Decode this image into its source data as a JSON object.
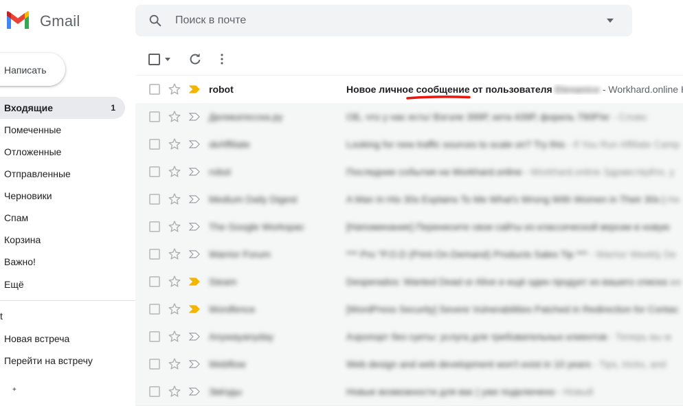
{
  "app": {
    "name": "Gmail",
    "brand_colors": {
      "red": "#ea4335",
      "blue": "#4285f4",
      "green": "#34a853",
      "yellow": "#fbbc04"
    }
  },
  "search": {
    "placeholder": "Поиск в почте",
    "value": ""
  },
  "compose": {
    "label": "Написать"
  },
  "sidebar": {
    "items": [
      {
        "label": "Входящие",
        "count": "1",
        "active": true
      },
      {
        "label": "Помеченные"
      },
      {
        "label": "Отложенные"
      },
      {
        "label": "Отправленные"
      },
      {
        "label": "Черновики"
      },
      {
        "label": "Спам"
      },
      {
        "label": "Корзина"
      },
      {
        "label": "Важно!"
      },
      {
        "label": "Ещё"
      }
    ],
    "meet": {
      "items": [
        {
          "label": "Новая встреча"
        },
        {
          "label": "Перейти на встречу"
        }
      ]
    }
  },
  "toolbar": {
    "icons": [
      "checkbox-icon",
      "chevron-down-icon",
      "refresh-icon",
      "more-vert-icon"
    ]
  },
  "messages": [
    {
      "sender": "robot",
      "subject": "Новое личное сообщение от пользователя",
      "redacted_name": "Elenanice",
      "snippet": " - Workhard.online Ho",
      "unread": true,
      "important": true,
      "underline_color": "#e8160c"
    },
    {
      "sender": "Деликатесска.ру",
      "subject": "ОБ, что у нас есть! Вэгэле 399Р, кета 439Р, форель 790Р/кг",
      "snippet": " - Слово",
      "important": false
    },
    {
      "sender": "skAffiliate",
      "subject": "Looking for new traffic sources to scale on? Try this",
      "snippet": " - If You Run Affiliate Camp",
      "important": false
    },
    {
      "sender": "robot",
      "subject": "Последние события на Workhard.online",
      "snippet": " - Workhard.online Здравствуйте, у",
      "important": false
    },
    {
      "sender": "Medium Daily Digest",
      "subject": "A Man In His 30s Explains To Me What's Wrong With Women in Their 30s |",
      "snippet": " He",
      "important": false
    },
    {
      "sender": "The Google Workspac",
      "subject": "[Напоминание] Перенесите свои сайты из классической версии в новую",
      "snippet": "",
      "important": false
    },
    {
      "sender": "Warrior Forum",
      "subject": "*** Pro \"P.O.D (Print-On-Demand) Products Sales Tip ***",
      "snippet": " - Warrior Weekly De",
      "important": false
    },
    {
      "sender": "Steam",
      "subject": "Desperados: Wanted Dead or Alive и ещё один продукт из вашего списка",
      "snippet": " же",
      "important": true
    },
    {
      "sender": "Wordfence",
      "subject": "[WordPress Security] Severe Vulnerabilities Patched in Redirection for Contac",
      "snippet": "",
      "important": true
    },
    {
      "sender": "Anywayanyday",
      "subject": "Аэропорт без суеты: услуга для требовательных клиентов",
      "snippet": " - Теперь вы м",
      "important": false
    },
    {
      "sender": "Webflow",
      "subject": "Web design and web development won't exist in 10 years",
      "snippet": " - Tips, tricks, and",
      "important": false
    },
    {
      "sender": "Звёзды",
      "subject": "Новые возможности для вас | уже подключено",
      "snippet": " - Новый",
      "important": false
    }
  ]
}
